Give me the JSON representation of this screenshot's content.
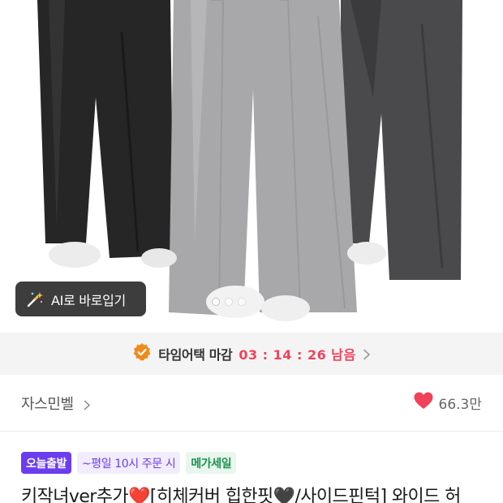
{
  "hero": {
    "ai_button_label": "AI로 바로입기",
    "carousel_dots": 3,
    "active_dot": 1
  },
  "time_attack": {
    "label": "타임어택 마감",
    "timer": "03 : 14 : 26 남음"
  },
  "store": {
    "name": "자스민벨",
    "likes": "66.3만"
  },
  "badges": {
    "today_label": "오늘출발",
    "today_note": "~평일 10시 주문 시",
    "mega_label": "메가세일"
  },
  "product": {
    "title": "키작녀ver추가❤️[히체커버 힙한핏🖤/사이드핀턱] 와이드 허"
  },
  "colors": {
    "accent_purple": "#6b3cf0",
    "timer_red": "#f0435a",
    "heart_red": "#f0435a",
    "mega_green": "#19924e",
    "badge_orange": "#f08a1c"
  }
}
